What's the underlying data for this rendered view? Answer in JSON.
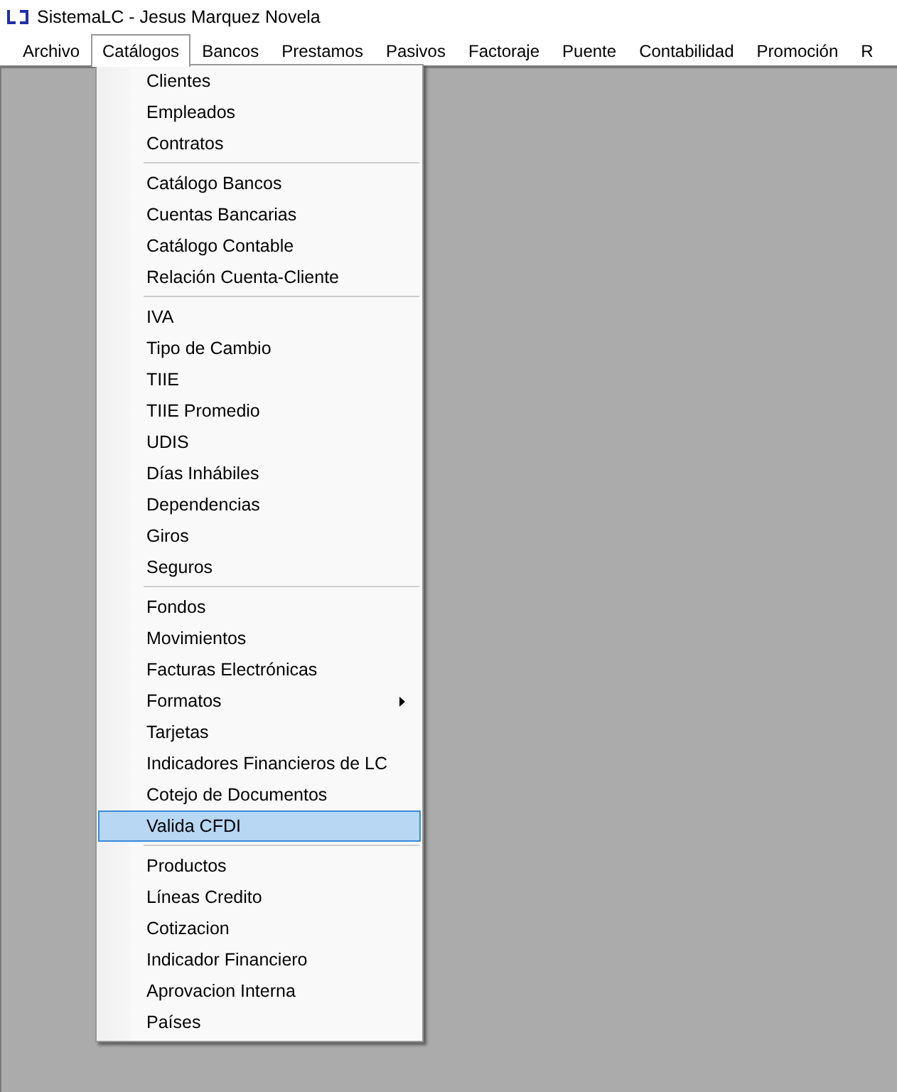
{
  "window": {
    "title": "SistemaLC - Jesus Marquez Novela"
  },
  "menu_bar": [
    {
      "label": "Archivo",
      "selected": false
    },
    {
      "label": "Catálogos",
      "selected": true
    },
    {
      "label": "Bancos",
      "selected": false
    },
    {
      "label": "Prestamos",
      "selected": false
    },
    {
      "label": "Pasivos",
      "selected": false
    },
    {
      "label": "Factoraje",
      "selected": false
    },
    {
      "label": "Puente",
      "selected": false
    },
    {
      "label": "Contabilidad",
      "selected": false
    },
    {
      "label": "Promoción",
      "selected": false
    },
    {
      "label": "R",
      "selected": false
    }
  ],
  "dropdown_menu": {
    "groups": [
      [
        {
          "label": "Clientes",
          "selected": false,
          "submenu": false
        },
        {
          "label": "Empleados",
          "selected": false,
          "submenu": false
        },
        {
          "label": "Contratos",
          "selected": false,
          "submenu": false
        }
      ],
      [
        {
          "label": "Catálogo Bancos",
          "selected": false,
          "submenu": false
        },
        {
          "label": "Cuentas Bancarias",
          "selected": false,
          "submenu": false
        },
        {
          "label": "Catálogo Contable",
          "selected": false,
          "submenu": false
        },
        {
          "label": "Relación Cuenta-Cliente",
          "selected": false,
          "submenu": false
        }
      ],
      [
        {
          "label": "IVA",
          "selected": false,
          "submenu": false
        },
        {
          "label": "Tipo de Cambio",
          "selected": false,
          "submenu": false
        },
        {
          "label": "TIIE",
          "selected": false,
          "submenu": false
        },
        {
          "label": "TIIE Promedio",
          "selected": false,
          "submenu": false
        },
        {
          "label": "UDIS",
          "selected": false,
          "submenu": false
        },
        {
          "label": "Días Inhábiles",
          "selected": false,
          "submenu": false
        },
        {
          "label": "Dependencias",
          "selected": false,
          "submenu": false
        },
        {
          "label": "Giros",
          "selected": false,
          "submenu": false
        },
        {
          "label": "Seguros",
          "selected": false,
          "submenu": false
        }
      ],
      [
        {
          "label": "Fondos",
          "selected": false,
          "submenu": false
        },
        {
          "label": "Movimientos",
          "selected": false,
          "submenu": false
        },
        {
          "label": "Facturas Electrónicas",
          "selected": false,
          "submenu": false
        },
        {
          "label": "Formatos",
          "selected": false,
          "submenu": true
        },
        {
          "label": "Tarjetas",
          "selected": false,
          "submenu": false
        },
        {
          "label": "Indicadores Financieros de LC",
          "selected": false,
          "submenu": false
        },
        {
          "label": "Cotejo de Documentos",
          "selected": false,
          "submenu": false
        },
        {
          "label": "Valida CFDI",
          "selected": true,
          "submenu": false
        }
      ],
      [
        {
          "label": "Productos",
          "selected": false,
          "submenu": false
        },
        {
          "label": "Líneas Credito",
          "selected": false,
          "submenu": false
        },
        {
          "label": "Cotizacion",
          "selected": false,
          "submenu": false
        },
        {
          "label": "Indicador Financiero",
          "selected": false,
          "submenu": false
        },
        {
          "label": "Aprovacion Interna",
          "selected": false,
          "submenu": false
        },
        {
          "label": "Países",
          "selected": false,
          "submenu": false
        }
      ]
    ]
  }
}
